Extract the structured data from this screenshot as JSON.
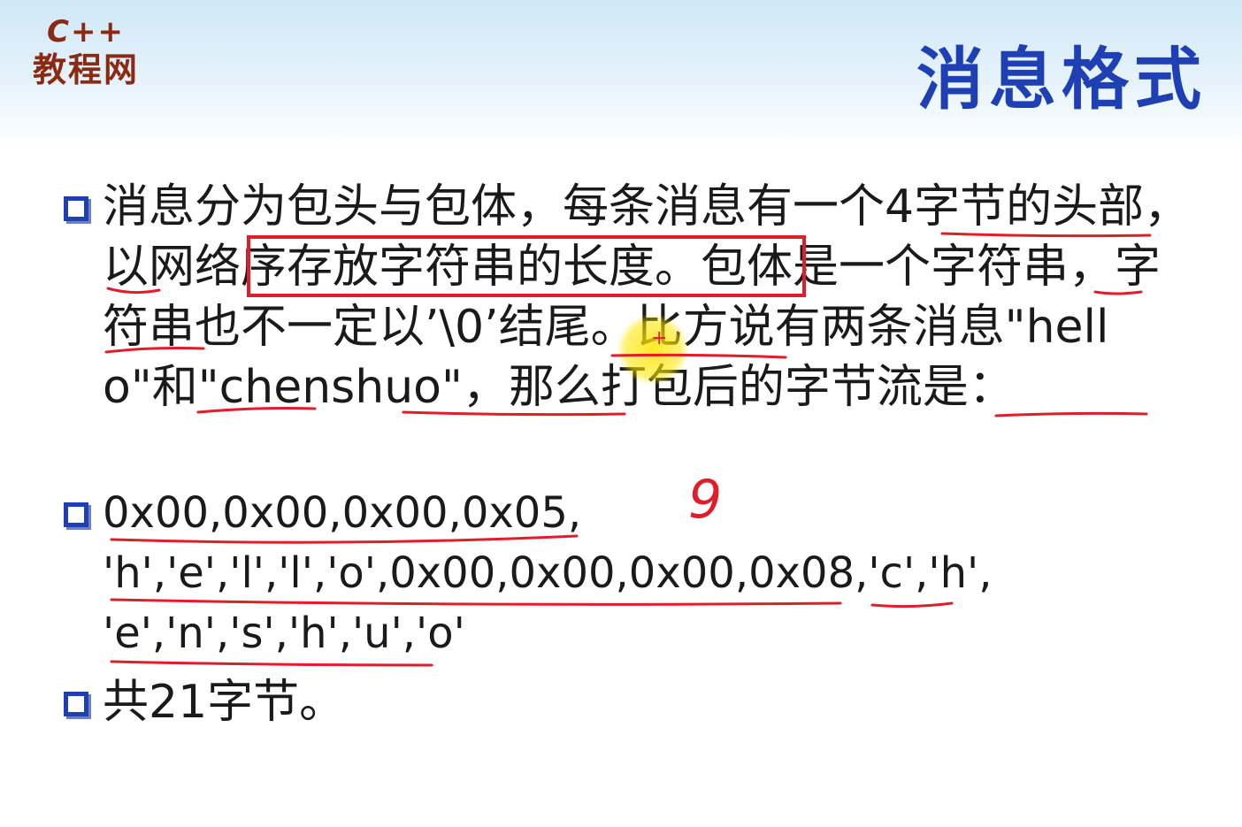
{
  "logo": {
    "top": "C++",
    "bottom": "教程网"
  },
  "title": "消息格式",
  "bullets": [
    {
      "text": "消息分为包头与包体，每条消息有一个4字节的头部，以网络序存放字符串的长度。包体是一个字符串，字符串也不一定以’\\0’结尾。比方说有两条消息\"hello\"和\"chenshuo\"，那么打包后的字节流是："
    },
    {
      "lines": [
        "0x00,0x00,0x00,0x05,",
        "'h','e','l','l','o',0x00,0x00,0x00,0x08,'c','h',",
        "'e','n','s','h','u','o'"
      ]
    },
    {
      "text": "共21字节。"
    }
  ],
  "handwriting": {
    "annotation": "9"
  },
  "colors": {
    "title": "#1f3fb5",
    "logo": "#8a2a12",
    "ink": "#e11d2a",
    "bullet": "#1f3fb5"
  }
}
